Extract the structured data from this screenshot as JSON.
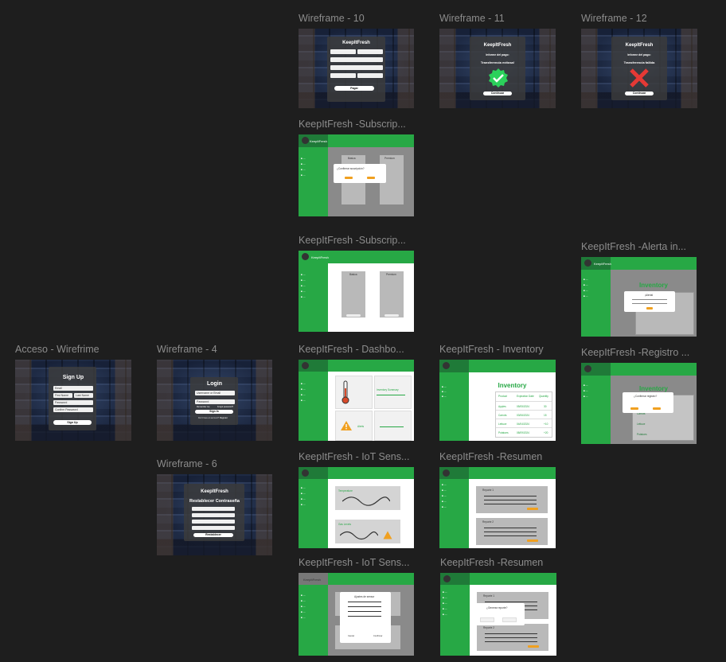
{
  "frames": {
    "wf10": "Wireframe - 10",
    "wf11": "Wireframe - 11",
    "wf12": "Wireframe - 12",
    "subs1": "KeepItFresh -Subscrip...",
    "subs2": "KeepItFresh -Subscrip...",
    "alerta": "KeepItFresh -Alerta in...",
    "acceso": "Acceso - Wirefrime",
    "wf4": "Wireframe - 4",
    "dash": "KeepItFresh - Dashbo...",
    "inventory": "KeepItFresh - Inventory",
    "registro": "KeepItFresh -Registro ...",
    "wf6": "Wireframe - 6",
    "iot1": "KeepItFresh - IoT Sens...",
    "resumen1": "KeepItFresh -Resumen",
    "iot2": "KeepItFresh - IoT Sens...",
    "resumen2": "KeepItFresh -Resumen"
  },
  "content": {
    "brand": "KeepItFresh",
    "wf10_button": "Pagar",
    "pago_info": "Informe del pago:",
    "pago_ok": "Transferencia exitosa!",
    "pago_fail": "Transferencia fallida",
    "continuar": "Continuar",
    "signup_title": "Sign Up",
    "signup_fields": [
      "Email",
      "First Name",
      "Last Name",
      "Password",
      "Confirm Password"
    ],
    "signup_button": "Sign Up",
    "login_title": "Login",
    "login_fields": [
      "Username or Email",
      "Password"
    ],
    "remember": "Remember me",
    "forgot": "Forgot password?",
    "login_button": "Sign In",
    "no_account": "Don't have an account?",
    "register": "Register",
    "reset_title": "Restablecer Contraseña",
    "reset_button": "Restablecer",
    "confirm_subscribe": "¿Confirmar suscripción?",
    "plans": [
      "Básica",
      "Premium"
    ],
    "inventory_title": "Inventory",
    "inventory_headers": [
      "Product",
      "Expiration Date",
      "Quantity"
    ],
    "inventory_rows": [
      [
        "Apples",
        "05/05/2024",
        "30"
      ],
      [
        "Carrots",
        "03/06/2024",
        "15"
      ],
      [
        "Lettuce",
        "04/04/2024",
        "+10"
      ],
      [
        "Potatoes",
        "08/09/2024",
        "+20"
      ]
    ],
    "alerta_title": "¡Alerta!",
    "confirm_register": "¿Confirmar registro?",
    "inventory_summary": "Inventory Summary",
    "alerts": "Alerts",
    "temperature": "Temperature",
    "gas_levels": "Gas Levels",
    "reporte1": "Reporte 1",
    "reporte2": "Reporte 2",
    "ajustes": "Ajustes de sensor",
    "generar_reporte": "¿Generar reporte?",
    "cancel": "Cancel",
    "confirm": "Confirmar"
  },
  "colors": {
    "green": "#27a845",
    "dark_green": "#1f7a38",
    "orange": "#f0a020",
    "canvas": "#1e1e1e"
  }
}
